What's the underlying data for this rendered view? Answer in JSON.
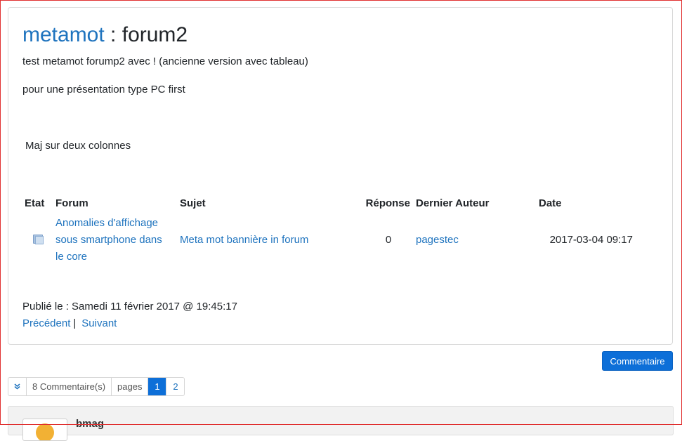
{
  "article": {
    "site": "metamot",
    "separator": " : ",
    "name": "forum2",
    "line1": "test metamot forump2 avec ! (ancienne version avec tableau)",
    "line2": "pour une présentation type PC first",
    "line3": "Maj sur deux colonnes"
  },
  "table": {
    "headers": [
      "Etat",
      "Forum",
      "Sujet",
      "Réponse",
      "Dernier Auteur",
      "Date"
    ],
    "row": {
      "etat_icon": "folder-icon",
      "forum_line1": "Anomalies d'affichage",
      "forum_line2": "sous smartphone dans",
      "forum_line3": "le core",
      "sujet": "Meta mot bannière in forum",
      "reponse": "0",
      "auteur": "pagestec",
      "date": "2017-03-04 09:17"
    }
  },
  "footer": {
    "published": "Publié le : Samedi 11 février 2017 @ 19:45:17",
    "prev": "Précédent",
    "sep": "|",
    "next": "Suivant"
  },
  "comment_button": "Commentaire",
  "pager": {
    "toggle_icon": "double-chevron-down-icon",
    "count": "8 Commentaire(s)",
    "pages_label": "pages",
    "pages": [
      "1",
      "2"
    ],
    "current": "1"
  },
  "comment": {
    "author": "bmag"
  },
  "colors": {
    "link": "#1e73be",
    "primary": "#0d6fd8",
    "border": "#d9d9d9"
  }
}
